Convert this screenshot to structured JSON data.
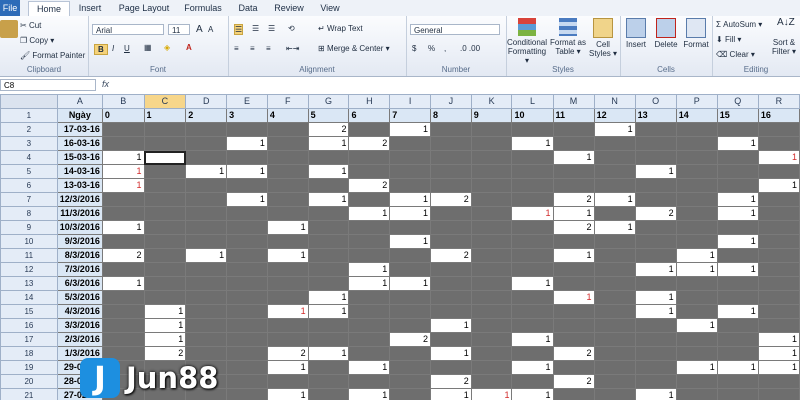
{
  "ribbon_tabs": [
    {
      "label": "File",
      "kind": "file"
    },
    {
      "label": "Home",
      "kind": "active"
    },
    {
      "label": "Insert",
      "kind": ""
    },
    {
      "label": "Page Layout",
      "kind": ""
    },
    {
      "label": "Formulas",
      "kind": ""
    },
    {
      "label": "Data",
      "kind": ""
    },
    {
      "label": "Review",
      "kind": ""
    },
    {
      "label": "View",
      "kind": ""
    }
  ],
  "clipboard": {
    "cut": "Cut",
    "copy": "Copy ▾",
    "format_painter": "Format Painter",
    "paste": "Paste",
    "label": "Clipboard"
  },
  "font": {
    "name": "Arial",
    "size": "11",
    "grow": "A",
    "shrink": "A",
    "bold": "B",
    "italic": "I",
    "underline": "U",
    "label": "Font"
  },
  "alignment": {
    "wrap_text": "Wrap Text",
    "merge_center": "Merge & Center ▾",
    "label": "Alignment"
  },
  "number": {
    "format": "General",
    "currency": "$",
    "percent": "%",
    "comma": ",",
    "label": "Number"
  },
  "styles": {
    "conditional": "Conditional Formatting ▾",
    "as_table": "Format as Table ▾",
    "cell_styles": "Cell Styles ▾",
    "label": "Styles"
  },
  "cells": {
    "insert": "Insert",
    "delete": "Delete",
    "format": "Format",
    "label": "Cells"
  },
  "editing": {
    "autosum": "AutoSum ▾",
    "fill": "Fill ▾",
    "clear": "Clear ▾",
    "sort": "Sort & Filter ▾",
    "label": "Editing"
  },
  "formula_bar": {
    "name_box": "C8",
    "fx": "fx",
    "value": ""
  },
  "columns": [
    "A",
    "B",
    "C",
    "D",
    "E",
    "F",
    "G",
    "H",
    "I",
    "J",
    "K",
    "L",
    "M",
    "N",
    "O",
    "P",
    "Q",
    "R"
  ],
  "selected_column": "C",
  "header_row": {
    "row_number": "1",
    "cells": [
      "Ngày",
      "0",
      "1",
      "2",
      "3",
      "4",
      "5",
      "6",
      "7",
      "8",
      "9",
      "10",
      "11",
      "12",
      "13",
      "14",
      "15",
      "16"
    ]
  },
  "rows": [
    {
      "n": "2",
      "date": "17-03-16",
      "v": {
        "5": "2",
        "7": "1",
        "12": "1"
      }
    },
    {
      "n": "3",
      "date": "16-03-16",
      "v": {
        "3": "1",
        "5": "1",
        "6": "2",
        "10": "1",
        "15": "1"
      }
    },
    {
      "n": "4",
      "date": "15-03-16",
      "v": {
        "0": "1",
        "11": "1",
        "16": "1r"
      }
    },
    {
      "n": "5",
      "date": "14-03-16",
      "v": {
        "0": "1r",
        "2": "1",
        "3": "1",
        "5": "1",
        "13": "1"
      }
    },
    {
      "n": "6",
      "date": "13-03-16",
      "v": {
        "0": "1r",
        "6": "2",
        "16": "1"
      }
    },
    {
      "n": "7",
      "date": "12/3/2016",
      "v": {
        "3": "1",
        "5": "1",
        "7": "1",
        "8": "2",
        "11": "2",
        "12": "1",
        "15": "1"
      }
    },
    {
      "n": "8",
      "date": "11/3/2016",
      "v": {
        "6": "1",
        "7": "1",
        "10": "1r",
        "11": "1",
        "13": "2",
        "15": "1"
      }
    },
    {
      "n": "9",
      "date": "10/3/2016",
      "v": {
        "0": "1",
        "4": "1",
        "11": "2",
        "12": "1"
      }
    },
    {
      "n": "10",
      "date": "9/3/2016",
      "v": {
        "7": "1",
        "15": "1"
      }
    },
    {
      "n": "11",
      "date": "8/3/2016",
      "v": {
        "0": "2",
        "2": "1",
        "4": "1",
        "8": "2",
        "11": "1",
        "14": "1"
      }
    },
    {
      "n": "12",
      "date": "7/3/2016",
      "v": {
        "6": "1",
        "13": "1",
        "14": "1",
        "15": "1"
      }
    },
    {
      "n": "13",
      "date": "6/3/2016",
      "v": {
        "0": "1",
        "6": "1",
        "7": "1",
        "10": "1"
      }
    },
    {
      "n": "14",
      "date": "5/3/2016",
      "v": {
        "5": "1",
        "11": "1r",
        "13": "1"
      }
    },
    {
      "n": "15",
      "date": "4/3/2016",
      "v": {
        "1": "1",
        "4": "1r",
        "5": "1",
        "13": "1",
        "15": "1"
      }
    },
    {
      "n": "16",
      "date": "3/3/2016",
      "v": {
        "1": "1",
        "8": "1",
        "14": "1"
      }
    },
    {
      "n": "17",
      "date": "2/3/2016",
      "v": {
        "1": "1",
        "7": "2",
        "10": "1",
        "16": "1"
      }
    },
    {
      "n": "18",
      "date": "1/3/2016",
      "v": {
        "1": "2",
        "4": "2",
        "5": "1",
        "8": "1",
        "11": "2",
        "16": "1"
      }
    },
    {
      "n": "19",
      "date": "29-02-16",
      "v": {
        "4": "1",
        "6": "1",
        "10": "1",
        "14": "1",
        "15": "1",
        "16": "1"
      }
    },
    {
      "n": "20",
      "date": "28-02-16",
      "v": {
        "8": "2",
        "11": "2"
      }
    },
    {
      "n": "21",
      "date": "27-02-16",
      "v": {
        "4": "1",
        "6": "1",
        "8": "1",
        "9": "1r",
        "10": "1",
        "13": "1"
      }
    }
  ],
  "selected_cell": {
    "row": "4",
    "col": "C"
  },
  "logo": {
    "text": "Jun88",
    "mark": "J"
  }
}
